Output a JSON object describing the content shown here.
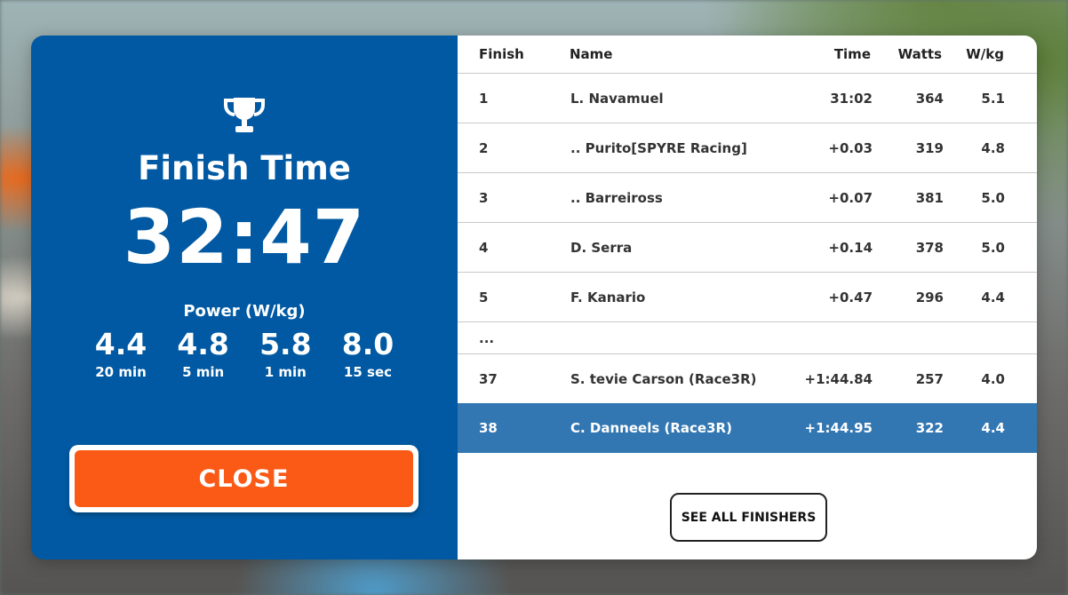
{
  "summary": {
    "finish_label": "Finish Time",
    "finish_time": "32:47",
    "power_label": "Power (W/kg)",
    "power": [
      {
        "value": "4.4",
        "period": "20 min"
      },
      {
        "value": "4.8",
        "period": "5 min"
      },
      {
        "value": "5.8",
        "period": "1 min"
      },
      {
        "value": "8.0",
        "period": "15 sec"
      }
    ],
    "close_label": "CLOSE"
  },
  "results": {
    "headers": {
      "finish": "Finish",
      "name": "Name",
      "time": "Time",
      "watts": "Watts",
      "wkg": "W/kg"
    },
    "rows": [
      {
        "finish": "1",
        "name": "L. Navamuel",
        "time": "31:02",
        "watts": "364",
        "wkg": "5.1"
      },
      {
        "finish": "2",
        "name": ".. Purito[SPYRE Racing]",
        "time": "+0.03",
        "watts": "319",
        "wkg": "4.8"
      },
      {
        "finish": "3",
        "name": ".. Barreiross",
        "time": "+0.07",
        "watts": "381",
        "wkg": "5.0"
      },
      {
        "finish": "4",
        "name": "D. Serra",
        "time": "+0.14",
        "watts": "378",
        "wkg": "5.0"
      },
      {
        "finish": "5",
        "name": "F. Kanario",
        "time": "+0.47",
        "watts": "296",
        "wkg": "4.4"
      },
      {
        "finish": "...",
        "name": "",
        "time": "",
        "watts": "",
        "wkg": ""
      },
      {
        "finish": "37",
        "name": "S. tevie Carson (Race3R)",
        "time": "+1:44.84",
        "watts": "257",
        "wkg": "4.0"
      },
      {
        "finish": "38",
        "name": "C. Danneels (Race3R)",
        "time": "+1:44.95",
        "watts": "322",
        "wkg": "4.4"
      }
    ],
    "see_all_label": "SEE ALL FINISHERS"
  },
  "colors": {
    "panel_blue": "#0059a2",
    "highlight_blue": "#3377b2",
    "close_orange": "#fa5a16"
  },
  "icons": {
    "trophy": "trophy-icon"
  }
}
